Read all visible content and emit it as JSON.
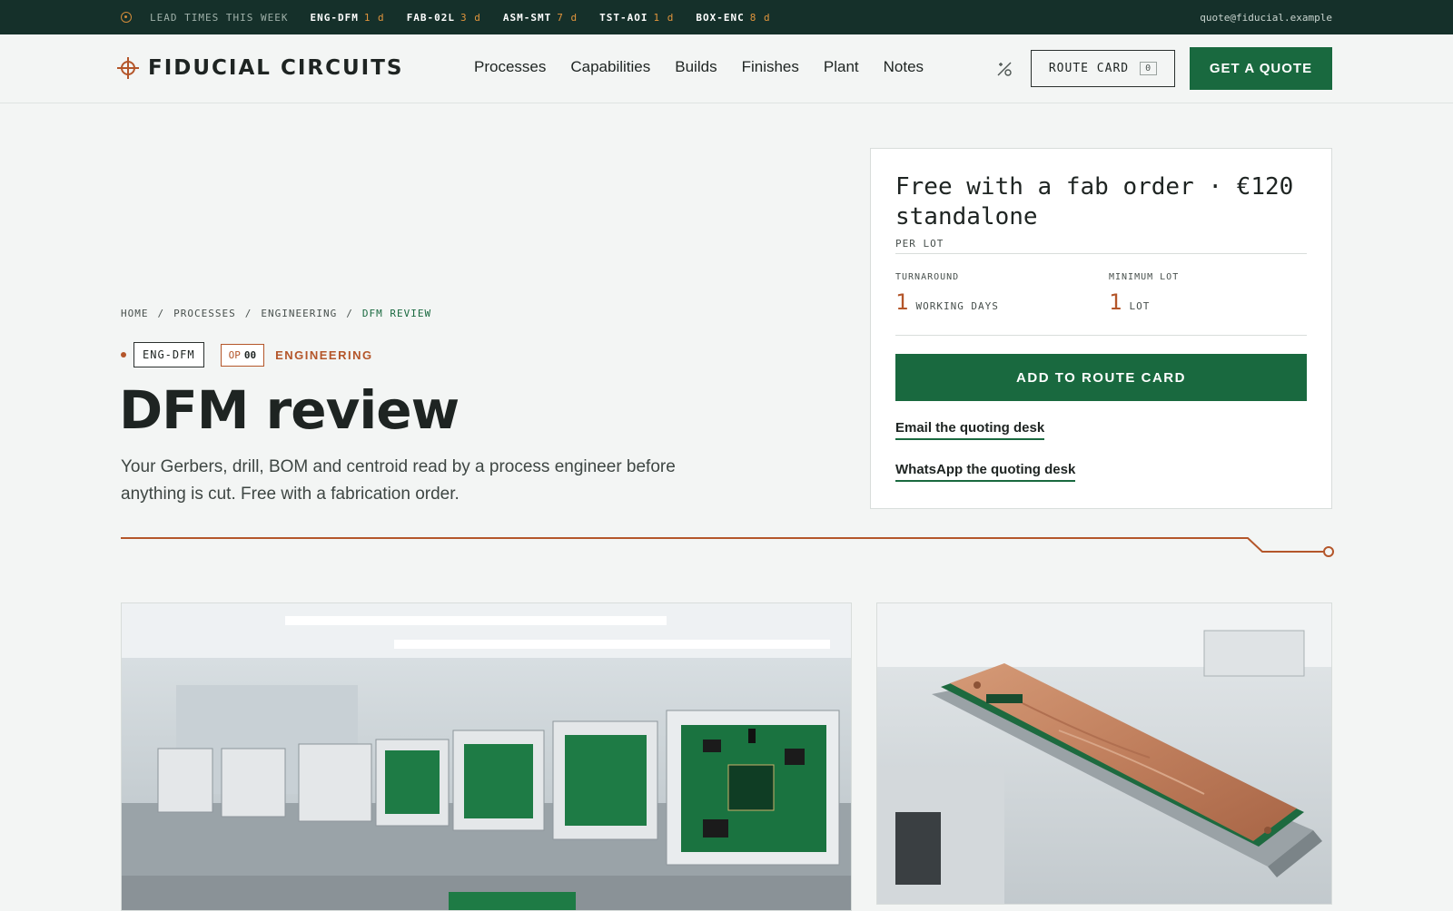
{
  "ticker": {
    "label": "LEAD TIMES THIS WEEK",
    "items": [
      {
        "code": "ENG-DFM",
        "days": "1 d"
      },
      {
        "code": "FAB-02L",
        "days": "3 d"
      },
      {
        "code": "ASM-SMT",
        "days": "7 d"
      },
      {
        "code": "TST-AOI",
        "days": "1 d"
      },
      {
        "code": "BOX-ENC",
        "days": "8 d"
      }
    ],
    "email": "quote@fiducial.example"
  },
  "header": {
    "brand": "FIDUCIAL CIRCUITS",
    "nav": [
      "Processes",
      "Capabilities",
      "Builds",
      "Finishes",
      "Plant",
      "Notes"
    ],
    "route_card_label": "ROUTE CARD",
    "route_card_count": "0",
    "quote_label": "GET A QUOTE"
  },
  "breadcrumb": {
    "items": [
      "HOME",
      "PROCESSES",
      "ENGINEERING"
    ],
    "current": "DFM REVIEW",
    "separator": "/"
  },
  "hero": {
    "code": "ENG-DFM",
    "op_label": "OP",
    "op_number": "00",
    "category": "ENGINEERING",
    "title": "DFM review",
    "lede": "Your Gerbers, drill, BOM and centroid read by a process engineer before anything is cut. Free with a fabrication order."
  },
  "pricing": {
    "price": "Free with a fab order · €120 standalone",
    "per": "PER LOT",
    "turnaround_label": "TURNAROUND",
    "turnaround_value": "1",
    "turnaround_unit": "WORKING DAYS",
    "min_lot_label": "MINIMUM LOT",
    "min_lot_value": "1",
    "min_lot_unit": "LOT",
    "add_label": "ADD TO ROUTE CARD",
    "email_link": "Email the quoting desk",
    "whatsapp_link": "WhatsApp the quoting desk"
  },
  "colors": {
    "dark_green": "#15302a",
    "brand_green": "#19693f",
    "copper": "#b4562a",
    "background": "#f3f5f4"
  }
}
